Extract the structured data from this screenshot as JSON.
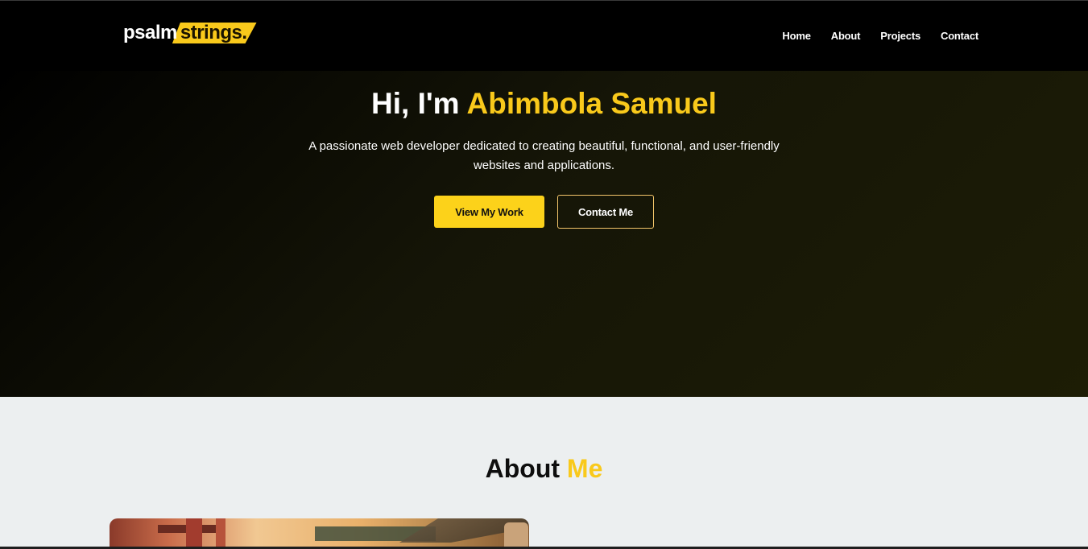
{
  "header": {
    "logo": {
      "part1": "psalm",
      "part2": "strings."
    },
    "nav": [
      "Home",
      "About",
      "Projects",
      "Contact"
    ]
  },
  "hero": {
    "title_prefix": "Hi, I'm ",
    "title_name": "Abimbola Samuel",
    "subtitle": "A passionate web developer dedicated to creating beautiful, functional, and user-friendly websites and applications.",
    "primary_button": "View My Work",
    "secondary_button": "Contact Me"
  },
  "about": {
    "title_prefix": "About ",
    "title_accent": "Me"
  },
  "colors": {
    "accent": "#f9c91b",
    "header_bg": "#000000",
    "about_bg": "#eceff0"
  }
}
